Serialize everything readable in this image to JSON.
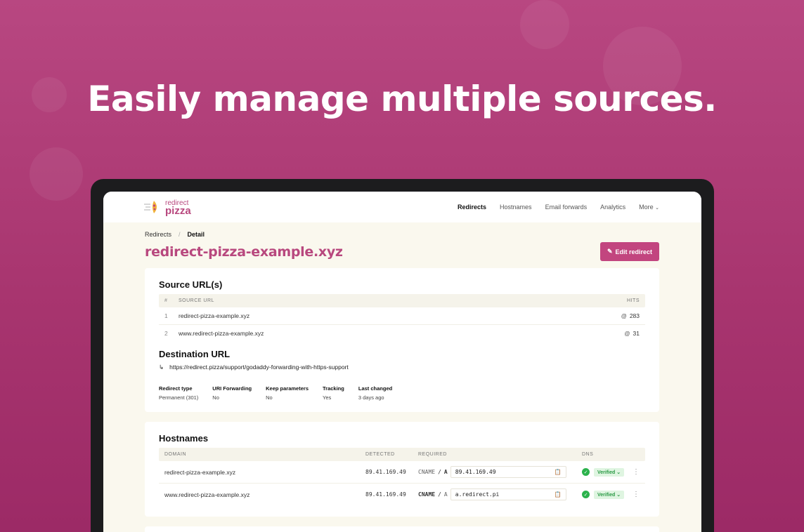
{
  "headline": "Easily manage multiple sources.",
  "brand": {
    "line1": "redirect",
    "line2": "pizza",
    "color": "#b8487e"
  },
  "nav": {
    "items": [
      "Redirects",
      "Hostnames",
      "Email forwards",
      "Analytics",
      "More"
    ],
    "active": "Redirects"
  },
  "breadcrumb": {
    "parent": "Redirects",
    "separator": "/",
    "current": "Detail"
  },
  "page": {
    "title": "redirect-pizza-example.xyz",
    "edit_label": "Edit redirect"
  },
  "source": {
    "heading": "Source URL(s)",
    "columns": {
      "num": "#",
      "url": "SOURCE URL",
      "hits": "HITS"
    },
    "rows": [
      {
        "num": "1",
        "url": "redirect-pizza-example.xyz",
        "hits": "283"
      },
      {
        "num": "2",
        "url": "www.redirect-pizza-example.xyz",
        "hits": "31"
      }
    ]
  },
  "destination": {
    "heading": "Destination URL",
    "url": "https://redirect.pizza/support/godaddy-forwarding-with-https-support"
  },
  "meta": [
    {
      "label": "Redirect type",
      "value": "Permanent (301)"
    },
    {
      "label": "URI Forwarding",
      "value": "No"
    },
    {
      "label": "Keep parameters",
      "value": "No"
    },
    {
      "label": "Tracking",
      "value": "Yes"
    },
    {
      "label": "Last changed",
      "value": "3 days ago"
    }
  ],
  "hostnames": {
    "heading": "Hostnames",
    "columns": {
      "domain": "DOMAIN",
      "detected": "DETECTED",
      "required": "REQUIRED",
      "dns": "DNS"
    },
    "rows": [
      {
        "domain": "redirect-pizza-example.xyz",
        "detected": "89.41.169.49",
        "type_a": "CNAME",
        "sep": "/",
        "type_b": "A",
        "value": "89.41.169.49",
        "status": "Verified"
      },
      {
        "domain": "www.redirect-pizza-example.xyz",
        "detected": "89.41.169.49",
        "type_a": "CNAME",
        "sep": "/",
        "type_b": "A",
        "value": "a.redirect.pi",
        "status": "Verified"
      }
    ]
  },
  "icons": {
    "edit": "pencil-icon",
    "hits": "at-sign-icon",
    "dest_arrow": "return-arrow-icon",
    "copy": "clipboard-icon",
    "verified": "check-circle-icon",
    "row_menu": "kebab-icon",
    "more": "chevron-down-icon"
  },
  "colors": {
    "accent": "#c2457f",
    "background": "#b84781",
    "success": "#2bb24c"
  }
}
